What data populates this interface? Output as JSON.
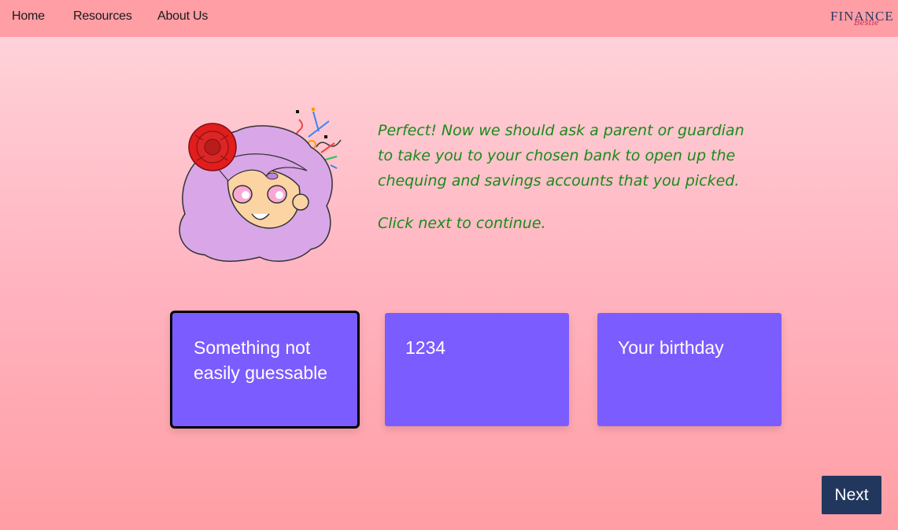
{
  "nav": {
    "items": [
      {
        "label": "Home"
      },
      {
        "label": "Resources"
      },
      {
        "label": "About Us"
      }
    ],
    "logo": {
      "main": "FINANCE",
      "sub": "Bestie"
    }
  },
  "message": {
    "text": "Perfect! Now we should ask a parent or guardian to take you to your chosen bank to open up the chequing and savings accounts that you picked.",
    "hint": "Click next to continue."
  },
  "options": [
    {
      "label": "Something not easily guessable",
      "selected": true
    },
    {
      "label": "1234",
      "selected": false
    },
    {
      "label": "Your birthday",
      "selected": false
    }
  ],
  "next_button": {
    "label": "Next"
  },
  "colors": {
    "navbar": "#ff9ea4",
    "option_bg": "#7b5cff",
    "message_text": "#1a8a1a",
    "next_bg": "#22375e"
  }
}
